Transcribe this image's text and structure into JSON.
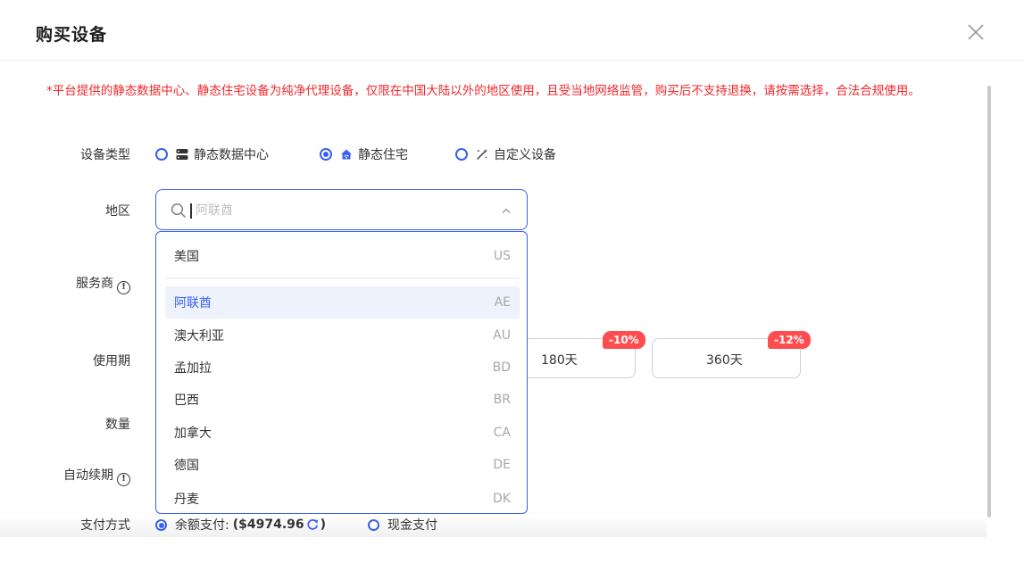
{
  "dialog": {
    "title": "购买设备",
    "notice": "*平台提供的静态数据中心、静态住宅设备为纯净代理设备，仅限在中国大陆以外的地区使用，且受当地网络监管，购买后不支持退换，请按需选择，合法合规使用。"
  },
  "form": {
    "device_type_label": "设备类型",
    "device_types": [
      {
        "label": "静态数据中心",
        "icon": "server-icon",
        "selected": false
      },
      {
        "label": "静态住宅",
        "icon": "home-wifi-icon",
        "selected": true
      },
      {
        "label": "自定义设备",
        "icon": "magic-wand-icon",
        "selected": false
      }
    ],
    "region_label": "地区",
    "region_placeholder": "阿联酋",
    "provider_label": "服务商",
    "period_label": "使用期",
    "periods": [
      {
        "label": "180天",
        "discount": "-10%"
      },
      {
        "label": "360天",
        "discount": "-12%"
      }
    ],
    "quantity_label": "数量",
    "auto_renew_label": "自动续期",
    "payment_label": "支付方式",
    "payment_options": [
      {
        "label": "余额支付:",
        "amount": "($4974.96",
        "suffix": ")",
        "selected": true
      },
      {
        "label": "现金支付",
        "selected": false
      }
    ]
  },
  "region_dropdown": {
    "pinned": {
      "name": "美国",
      "code": "US"
    },
    "items": [
      {
        "name": "阿联酋",
        "code": "AE",
        "selected": true
      },
      {
        "name": "澳大利亚",
        "code": "AU"
      },
      {
        "name": "孟加拉",
        "code": "BD"
      },
      {
        "name": "巴西",
        "code": "BR"
      },
      {
        "name": "加拿大",
        "code": "CA"
      },
      {
        "name": "德国",
        "code": "DE"
      },
      {
        "name": "丹麦",
        "code": "DK"
      }
    ]
  },
  "colors": {
    "accent": "#3860f4",
    "warning": "#f0282d",
    "discount_badge": "#ff4d4f"
  }
}
